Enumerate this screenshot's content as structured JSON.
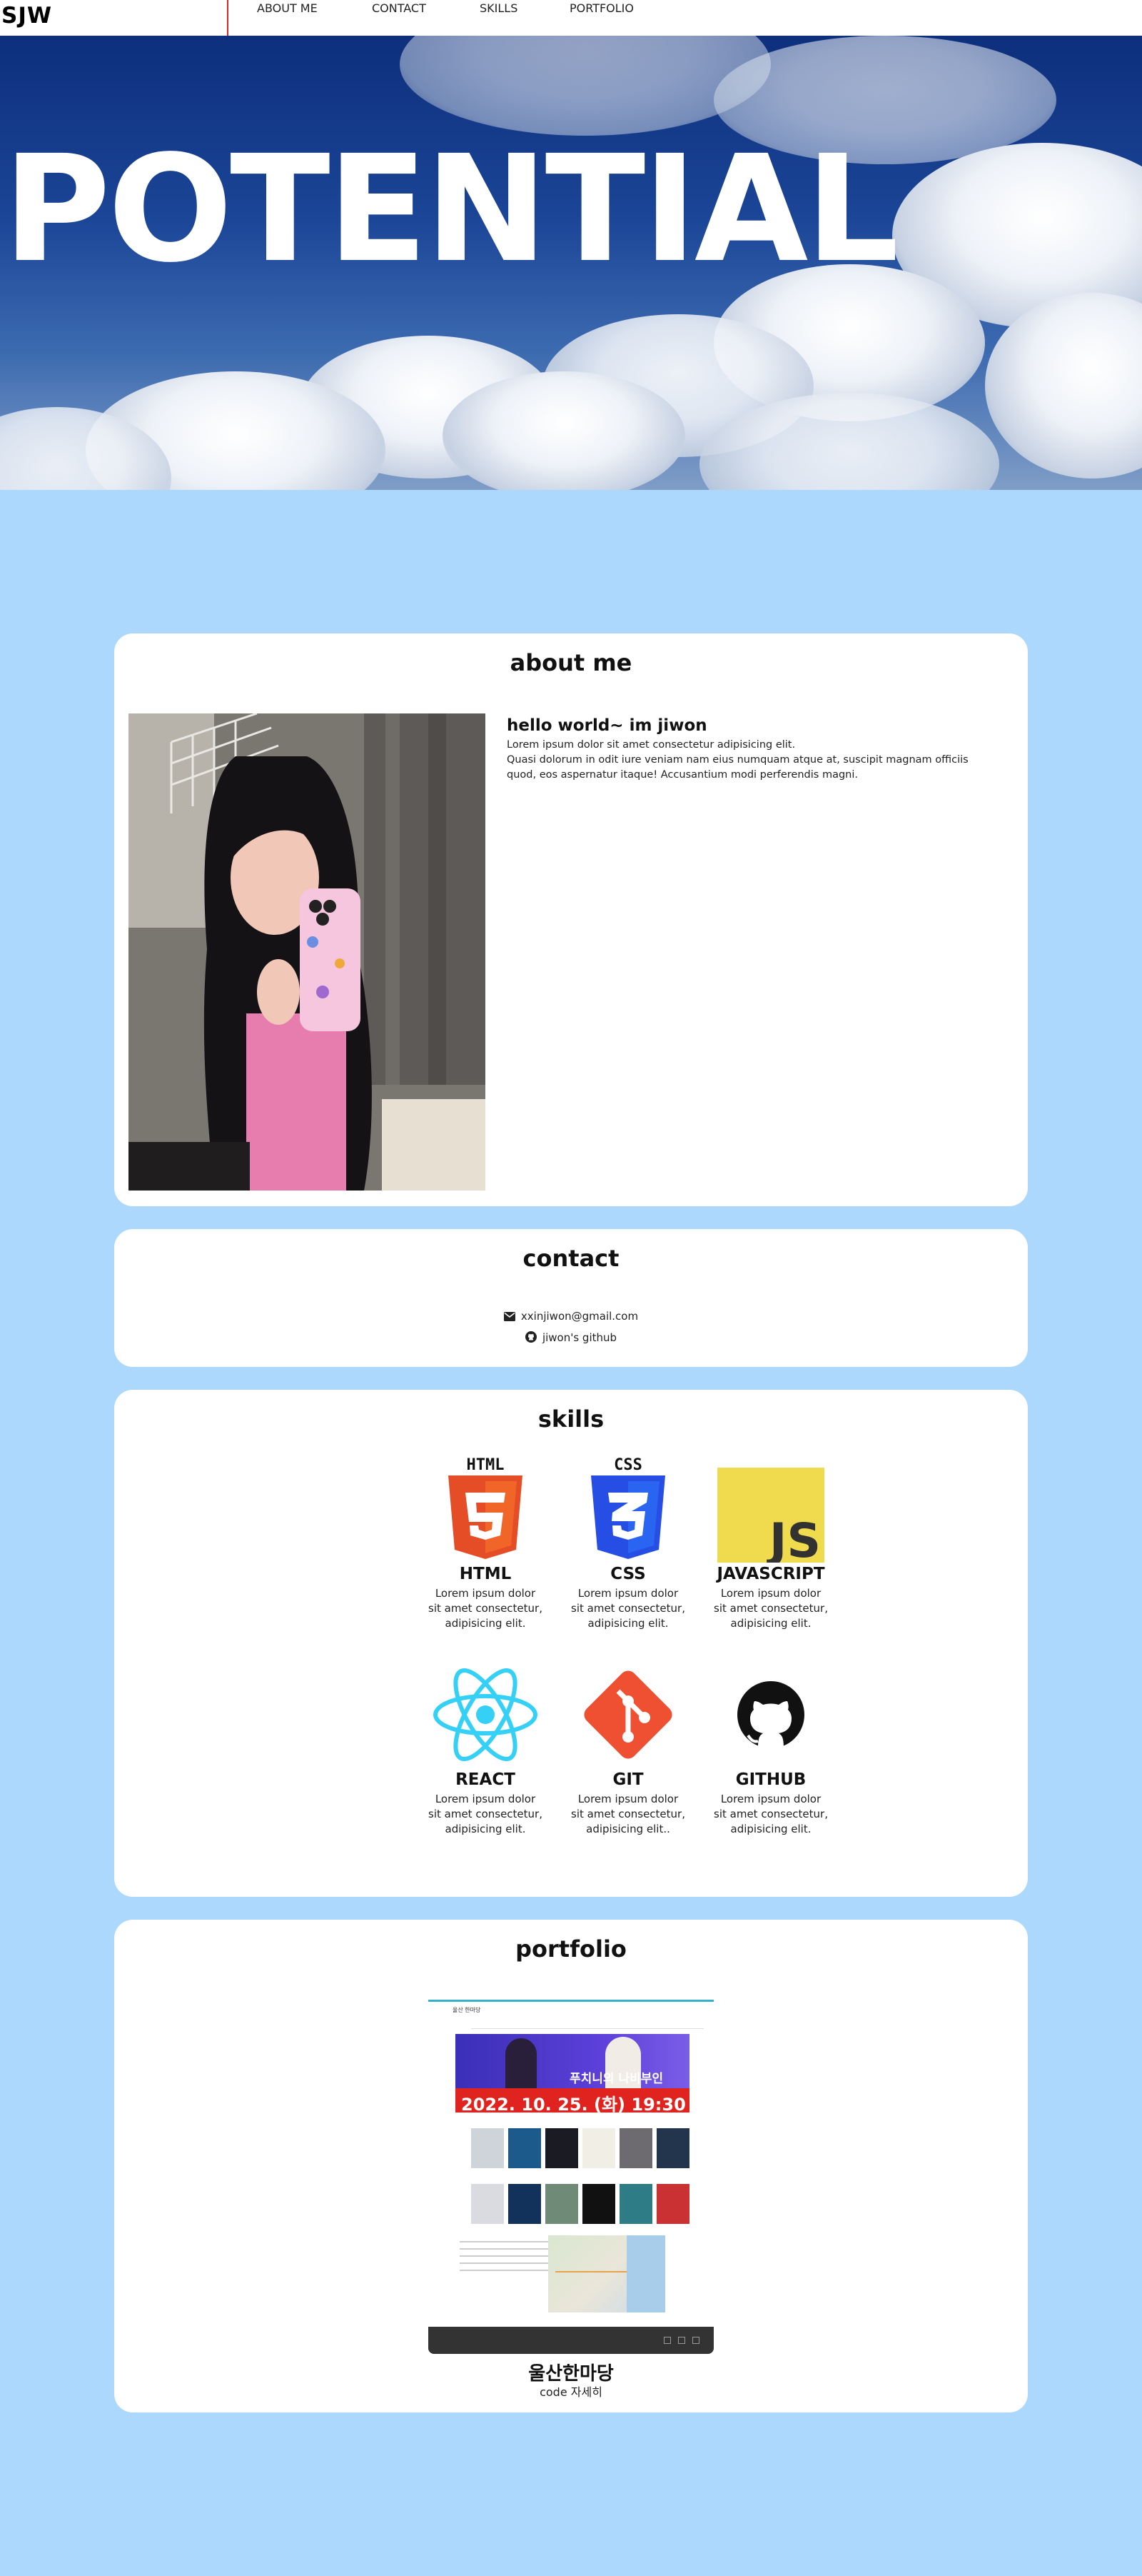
{
  "nav": {
    "logo": "SJW",
    "links": [
      "ABOUT ME",
      "CONTACT",
      "SKILLS",
      "PORTFOLIO"
    ]
  },
  "hero": {
    "title": "POTENTIAL"
  },
  "about": {
    "title": "about me",
    "heading": "hello world~ im jiwon",
    "line1": "Lorem ipsum dolor sit amet consectetur adipisicing elit.",
    "line2": "Quasi dolorum in odit iure veniam nam eius numquam atque at, suscipit magnam officiis quod, eos aspernatur itaque! Accusantium modi perferendis magni."
  },
  "contact": {
    "title": "contact",
    "email": "xxinjiwon@gmail.com",
    "github": "jiwon's github"
  },
  "skills": {
    "title": "skills",
    "items": [
      {
        "name": "HTML",
        "desc": "Lorem ipsum dolor sit amet consectetur, adipisicing elit.",
        "icon": "html5-icon"
      },
      {
        "name": "CSS",
        "desc": "Lorem ipsum dolor sit amet consectetur, adipisicing elit.",
        "icon": "css3-icon"
      },
      {
        "name": "JAVASCRIPT",
        "desc": "Lorem ipsum dolor sit amet consectetur, adipisicing elit.",
        "icon": "javascript-icon"
      },
      {
        "name": "REACT",
        "desc": "Lorem ipsum dolor sit amet consectetur, adipisicing elit.",
        "icon": "react-icon"
      },
      {
        "name": "GIT",
        "desc": "Lorem ipsum dolor sit amet consectetur, adipisicing elit..",
        "icon": "git-icon"
      },
      {
        "name": "GITHUB",
        "desc": "Lorem ipsum dolor sit amet consectetur, adipisicing elit.",
        "icon": "github-icon"
      }
    ]
  },
  "portfolio": {
    "title": "portfolio",
    "project_title": "울산한마당",
    "project_link": "code 자세히",
    "shot": {
      "site_name": "울산 한마당",
      "banner_text": "푸치니의 나비부인",
      "banner_date": "2022. 10. 25. (화) 19:30"
    }
  },
  "colors": {
    "page_bg": "#acd8fd",
    "card_bg": "#ffffff",
    "nav_divider": "#e3252a",
    "html": "#e44d26",
    "css": "#264de4",
    "js": "#f0db4f",
    "react": "#61dafb",
    "git": "#f05032"
  }
}
